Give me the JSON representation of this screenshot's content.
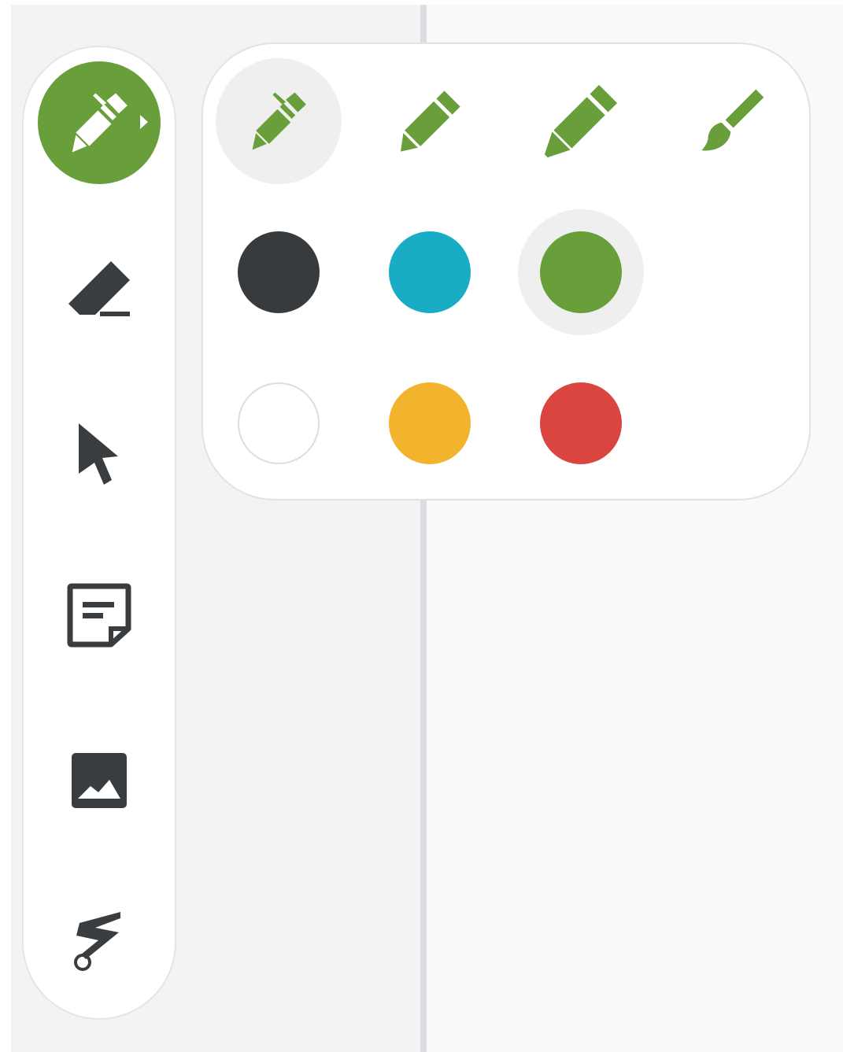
{
  "colors": {
    "accent": "#689f3a",
    "icon_dark": "#3a3d40"
  },
  "toolbar": {
    "tools": [
      {
        "name": "pen-tool-button",
        "icon": "pen-icon",
        "active": true
      },
      {
        "name": "eraser-tool-button",
        "icon": "eraser-icon",
        "active": false
      },
      {
        "name": "select-tool-button",
        "icon": "cursor-arrow-icon",
        "active": false
      },
      {
        "name": "sticky-note-tool-button",
        "icon": "sticky-note-icon",
        "active": false
      },
      {
        "name": "image-tool-button",
        "icon": "image-icon",
        "active": false
      },
      {
        "name": "laser-pointer-tool-button",
        "icon": "laser-pointer-icon",
        "active": false
      }
    ]
  },
  "pen_flyout": {
    "pen_types": [
      {
        "icon": "pen-icon",
        "selected": true
      },
      {
        "icon": "marker-icon",
        "selected": false
      },
      {
        "icon": "highlighter-icon",
        "selected": false
      },
      {
        "icon": "brush-icon",
        "selected": false
      }
    ],
    "swatches": [
      {
        "name": "black",
        "hex": "#383b3e",
        "selected": false
      },
      {
        "name": "blue",
        "hex": "#19adc5",
        "selected": false
      },
      {
        "name": "green",
        "hex": "#689f3a",
        "selected": true
      },
      {
        "name": "white",
        "hex": "#ffffff",
        "selected": false
      },
      {
        "name": "yellow",
        "hex": "#f3b42d",
        "selected": false
      },
      {
        "name": "red",
        "hex": "#da4540",
        "selected": false
      }
    ]
  }
}
